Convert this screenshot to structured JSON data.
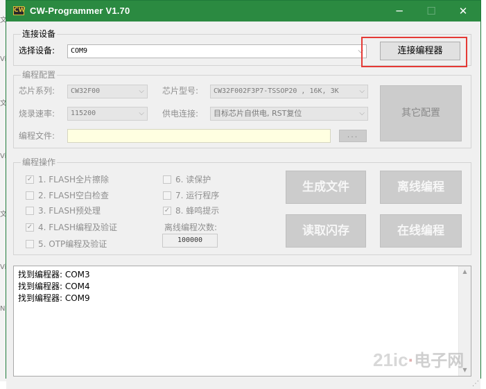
{
  "app": {
    "title": "CW-Programmer V1.70",
    "icon_text": "CW",
    "controls": {
      "minimize": "─",
      "maximize": "☐",
      "close": "✕"
    }
  },
  "connect_group": {
    "title": "连接设备",
    "device_label": "选择设备:",
    "device_value": "COM9",
    "connect_button": "连接编程器"
  },
  "config_group": {
    "title": "编程配置",
    "chip_series_label": "芯片系列:",
    "chip_series_value": "CW32F00",
    "chip_model_label": "芯片型号:",
    "chip_model_value": "CW32F002F3P7-TSSOP20  , 16K, 3K",
    "burn_speed_label": "烧录速率:",
    "burn_speed_value": "115200",
    "power_label": "供电连接:",
    "power_value": "目标芯片自供电, RST复位",
    "file_label": "编程文件:",
    "file_value": "",
    "browse_button": "...",
    "other_config_button": "其它配置"
  },
  "ops_group": {
    "title": "编程操作",
    "options": [
      {
        "label": "1.  FLASH全片擦除",
        "checked": true
      },
      {
        "label": "2.  FLASH空白检查",
        "checked": false
      },
      {
        "label": "3.  FLASH预处理",
        "checked": false
      },
      {
        "label": "4.  FLASH编程及验证",
        "checked": true
      },
      {
        "label": "5.  OTP编程及验证",
        "checked": false
      },
      {
        "label": "6.  读保护",
        "checked": false
      },
      {
        "label": "7.  运行程序",
        "checked": false
      },
      {
        "label": "8.  蜂鸣提示",
        "checked": true
      }
    ],
    "offline_count_label": "离线编程次数:",
    "offline_count_value": "100000",
    "buttons": {
      "generate_file": "生成文件",
      "offline_program": "离线编程",
      "read_flash": "读取闪存",
      "online_program": "在线编程"
    }
  },
  "log": {
    "lines": [
      "找到编程器: COM3",
      "找到编程器: COM4",
      "找到编程器: COM9"
    ]
  },
  "watermark": {
    "text": "21ic",
    "cn": "电子网"
  },
  "colors": {
    "titlebar": "#2b8a41",
    "highlight": "#e53935",
    "file_input_bg": "#ffffe1"
  }
}
